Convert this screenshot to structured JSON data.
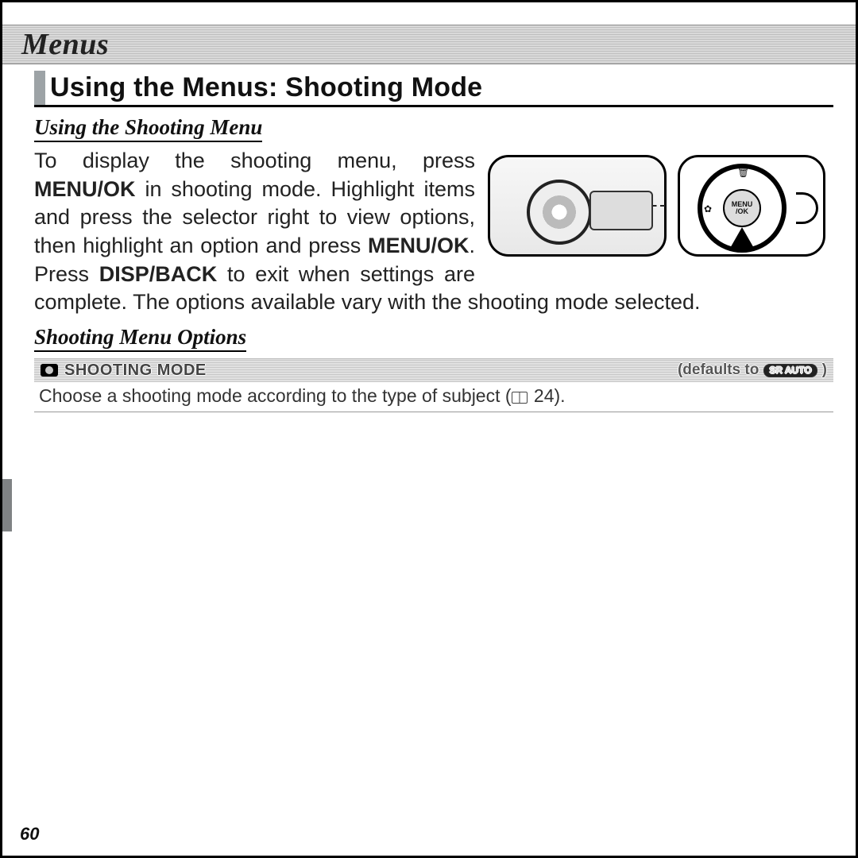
{
  "chapter": {
    "title": "Menus"
  },
  "section": {
    "heading": "Using the Menus: Shooting Mode",
    "sub1": "Using the Shooting Menu",
    "sub2": "Shooting Menu Options"
  },
  "paragraph": {
    "t1": "To display the shooting menu, press ",
    "b1": "MENU/OK",
    "t2": " in shooting mode. Highlight items and press the selector right to view options, then highlight an option and press ",
    "b2": "MENU/OK",
    "t3": ". Press ",
    "b3": "DISP/BACK",
    "t4": " to exit when settings are complete. The options available vary with the shooting mode selected."
  },
  "dial": {
    "hub": "MENU /OK"
  },
  "option": {
    "title": "SHOOTING MODE",
    "defaults_prefix": "(defaults to ",
    "defaults_badge": "SR AUTO",
    "defaults_suffix": ")",
    "desc_a": "Choose a shooting mode according to the type of subject (",
    "desc_pg": " 24).",
    "page_ref": "24"
  },
  "page_number": "60"
}
